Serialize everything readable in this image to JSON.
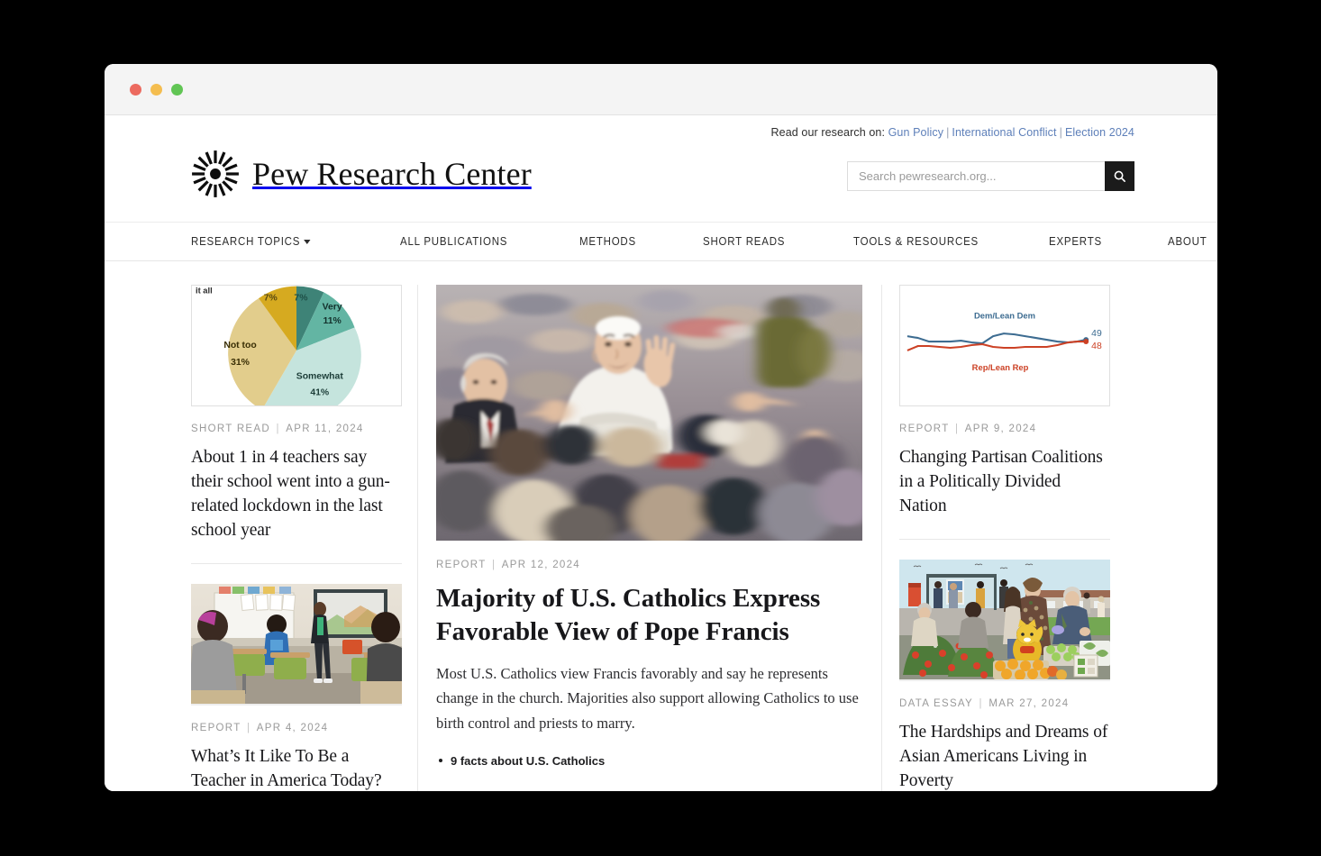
{
  "window": {
    "traffic_lights": [
      "close",
      "minimize",
      "zoom"
    ],
    "colors": {
      "close": "#ec6a5f",
      "minimize": "#f4bd4f",
      "zoom": "#61c554"
    }
  },
  "utility": {
    "label": "Read our research on:",
    "links": [
      "Gun Policy",
      "International Conflict",
      "Election 2024"
    ],
    "separator": "|",
    "link_color": "#5d7fb9"
  },
  "brand": {
    "name": "Pew Research Center",
    "mark": "sunburst-logo"
  },
  "search": {
    "placeholder": "Search pewresearch.org...",
    "value": "",
    "button_icon": "search-icon"
  },
  "nav": {
    "items": [
      {
        "label": "RESEARCH TOPICS",
        "has_dropdown": true
      },
      {
        "label": "ALL PUBLICATIONS",
        "has_dropdown": false
      },
      {
        "label": "METHODS",
        "has_dropdown": false
      },
      {
        "label": "SHORT READS",
        "has_dropdown": false
      },
      {
        "label": "TOOLS & RESOURCES",
        "has_dropdown": false
      },
      {
        "label": "EXPERTS",
        "has_dropdown": false
      },
      {
        "label": "ABOUT",
        "has_dropdown": false
      }
    ]
  },
  "left_column": {
    "cards": [
      {
        "media": "pie-chart-thumbnail",
        "kicker": "SHORT READ",
        "date": "APR 11, 2024",
        "title": "About 1 in 4 teachers say their school went into a gun-related lockdown in the last school year"
      },
      {
        "media": "classroom-photo-thumbnail",
        "kicker": "REPORT",
        "date": "APR 4, 2024",
        "title": "What’s It Like To Be a Teacher in America Today?"
      }
    ]
  },
  "feature": {
    "media": "pope-francis-crowd-photo",
    "kicker": "REPORT",
    "date": "APR 12, 2024",
    "title": "Majority of U.S. Catholics Express Favorable View of Pope Francis",
    "dek": "Most U.S. Catholics view Francis favorably and say he represents change in the church. Majorities also support allowing Catholics to use birth control and priests to marry.",
    "related": [
      "9 facts about U.S. Catholics"
    ]
  },
  "right_column": {
    "cards": [
      {
        "media": "partisan-line-chart-thumbnail",
        "kicker": "REPORT",
        "date": "APR 9, 2024",
        "title": "Changing Partisan Coalitions in a Politically Divided Nation"
      },
      {
        "media": "market-illustration-thumbnail",
        "kicker": "DATA ESSAY",
        "date": "MAR 27, 2024",
        "title": "The Hardships and Dreams of Asian Americans Living in Poverty"
      }
    ]
  },
  "chart_data": [
    {
      "type": "pie",
      "title": "",
      "clipped_label": "it all",
      "labels": [
        "Not at all",
        "",
        "Very",
        "Somewhat",
        "Not too"
      ],
      "slices": [
        {
          "label": "",
          "value": 7,
          "display": "7%",
          "color": "#3e8377"
        },
        {
          "label": "Very",
          "value": 11,
          "display": "11%",
          "color": "#63b5a3"
        },
        {
          "label": "Somewhat",
          "value": 41,
          "display": "41%",
          "color": "#c5e4dd"
        },
        {
          "label": "Not too",
          "value": 31,
          "display": "31%",
          "color": "#e2cd8c"
        },
        {
          "label": "",
          "value": 7,
          "display": "7%",
          "color": "#d6aa20"
        }
      ],
      "legend": "inline-labels"
    },
    {
      "type": "line",
      "title": "",
      "series": [
        {
          "name": "Dem/Lean Dem",
          "color": "#3d6c91",
          "end_value": 49,
          "values": [
            50,
            49.5,
            48.6,
            48.6,
            48.6,
            48.7,
            48.4,
            48.2,
            49.4,
            50.1,
            49.9,
            49.6,
            49.3,
            49.0,
            48.6,
            48.4,
            48.6,
            49.0
          ]
        },
        {
          "name": "Rep/Lean Rep",
          "color": "#cc4125",
          "end_value": 48,
          "values": [
            46.4,
            47.2,
            47.2,
            47.0,
            46.9,
            47.0,
            47.5,
            47.8,
            47.0,
            46.8,
            46.9,
            47.0,
            47.0,
            47.1,
            47.4,
            48.1,
            48.4,
            48.3
          ]
        }
      ],
      "end_labels": [
        "49",
        "48"
      ],
      "ylim": [
        44,
        54
      ],
      "grid": false,
      "legend": "inline-series-labels"
    }
  ]
}
